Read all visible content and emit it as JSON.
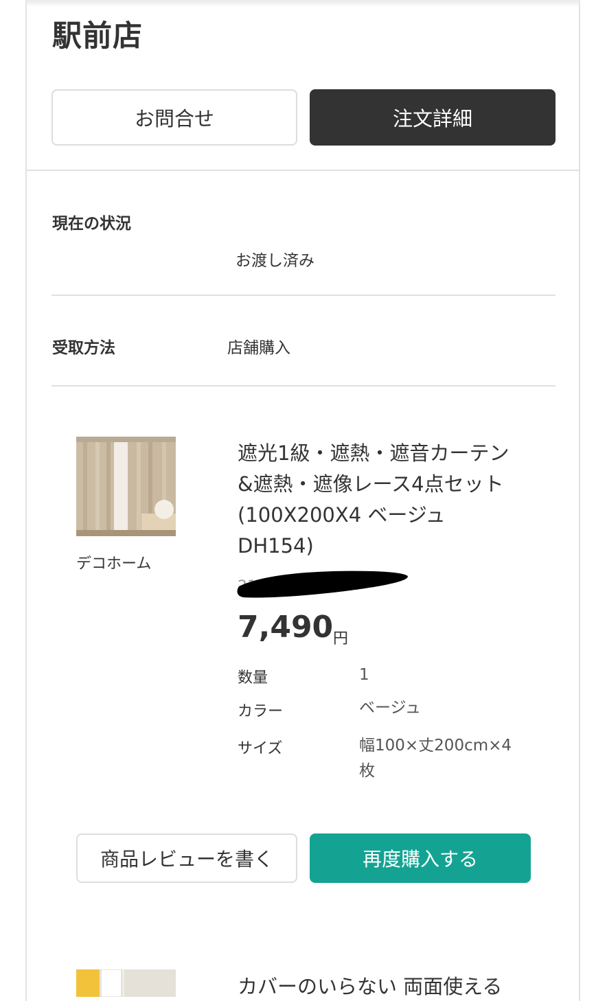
{
  "order": {
    "store_name": "駅前店",
    "contact_button": "お問合せ",
    "detail_button": "注文詳細"
  },
  "status": {
    "label": "現在の状況",
    "value": "お渡し済み"
  },
  "pickup": {
    "label": "受取方法",
    "value": "店舗購入"
  },
  "product": {
    "image_icon": "curtain-product-image",
    "brand": "デコホーム",
    "title": "遮光1級・遮熱・遮音カーテン\n&遮熱・遮像レース4点セット\n(100X200X4 ベージュ\nDH154)",
    "code": "21",
    "price": "7,490",
    "currency": "円",
    "specs": [
      {
        "label": "数量",
        "value": "1"
      },
      {
        "label": "カラー",
        "value": "ベージュ"
      },
      {
        "label": "サイズ",
        "value": "幅100×丈200cm×4\n枚"
      }
    ],
    "review_button": "商品レビューを書く",
    "rebuy_button": "再度購入する"
  },
  "next_product": {
    "title": "カバーのいらない 両面使える"
  },
  "colors": {
    "dark_button": "#333333",
    "accent_green": "#14a393",
    "divider": "#e0e0e0"
  }
}
